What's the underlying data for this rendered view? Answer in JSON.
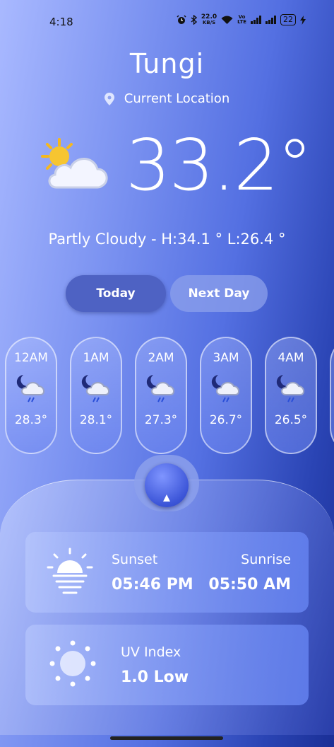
{
  "status_bar": {
    "time": "4:18",
    "net_speed_value": "22.0",
    "net_speed_unit": "KB/S",
    "volte_top": "Vo",
    "volte_bottom": "LTE",
    "battery": "22"
  },
  "header": {
    "city": "Tungi",
    "location_label": "Current Location"
  },
  "current": {
    "temperature": "33.2°",
    "condition_icon": "partly-cloudy-day-icon",
    "summary": "Partly Cloudy  -  H:34.1 °  L:26.4 °"
  },
  "day_toggle": {
    "today": "Today",
    "next_day": "Next Day",
    "selected": "today"
  },
  "hourly": [
    {
      "time": "12AM",
      "temp": "28.3°",
      "icon": "night-cloud-rain-icon"
    },
    {
      "time": "1AM",
      "temp": "28.1°",
      "icon": "night-cloud-rain-icon"
    },
    {
      "time": "2AM",
      "temp": "27.3°",
      "icon": "night-cloud-rain-icon"
    },
    {
      "time": "3AM",
      "temp": "26.7°",
      "icon": "night-cloud-rain-icon"
    },
    {
      "time": "4AM",
      "temp": "26.5°",
      "icon": "night-cloud-rain-icon"
    }
  ],
  "sun_card": {
    "sunset_label": "Sunset",
    "sunset_time": "05:46 PM",
    "sunrise_label": "Sunrise",
    "sunrise_time": "05:50 AM",
    "icon": "sunset-icon"
  },
  "uv_card": {
    "label": "UV Index",
    "value": "1.0 Low",
    "icon": "sun-icon"
  },
  "colors": {
    "accent_button": "#4e62c3",
    "sun_yellow": "#f6c531",
    "cloud_white": "#f3f5ff"
  }
}
